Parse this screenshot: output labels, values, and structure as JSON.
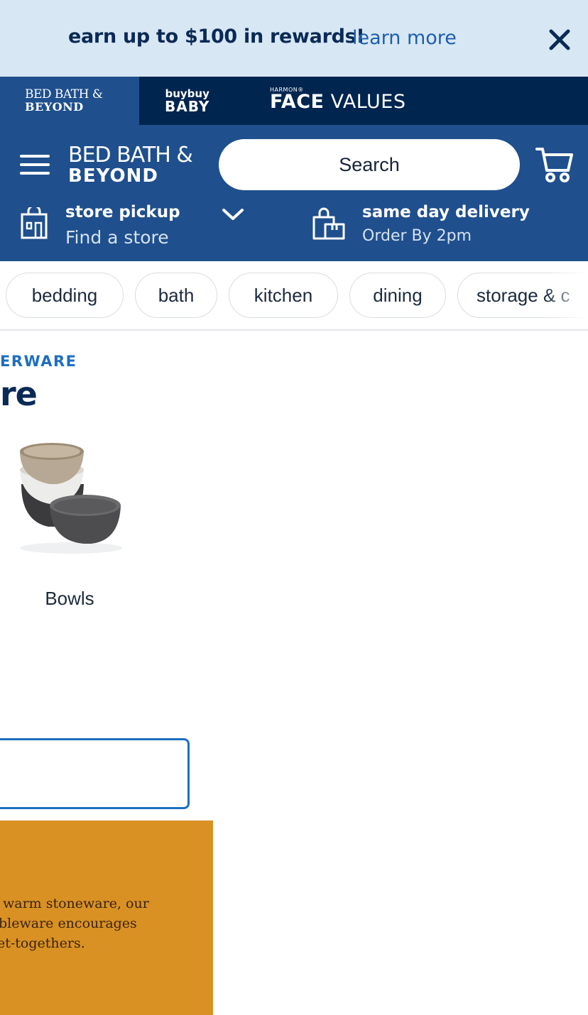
{
  "promo_banner": {
    "text": "earn up to $100 in rewards!",
    "link": "learn more",
    "close_icon": "close-icon"
  },
  "brand_bar": {
    "bed_bath": {
      "line1": "BED BATH &",
      "line2": "BEYOND"
    },
    "buybuy_baby": {
      "line1": "buybuy",
      "line2": "BABY"
    },
    "harmon": {
      "line1": "HARMON®",
      "line2_bold": "FACE",
      "line2_rest": " VALUES"
    }
  },
  "header": {
    "logo": {
      "line1": "BED BATH &",
      "line2": "BEYOND"
    },
    "search": {
      "placeholder": "Search"
    },
    "store_pickup": {
      "title": "store pickup",
      "subtitle": "Find a store"
    },
    "same_day_delivery": {
      "title": "same day delivery",
      "subtitle": "Order By 2pm"
    }
  },
  "categories": [
    "bedding",
    "bath",
    "kitchen",
    "dining",
    "storage & c"
  ],
  "content": {
    "breadcrumb": "ERWARE",
    "title": "re",
    "subcategory": {
      "label": "Bowls"
    },
    "promo_tile": {
      "lines": [
        "warm stoneware, our",
        "bleware encourages",
        "et-togethers."
      ]
    }
  },
  "colors": {
    "promo_bg": "#d8e7f4",
    "brand_bar_bg": "#00254f",
    "header_bg": "#1f4f8d",
    "accent_blue": "#1d6fbf",
    "tile_orange": "#d99124"
  }
}
